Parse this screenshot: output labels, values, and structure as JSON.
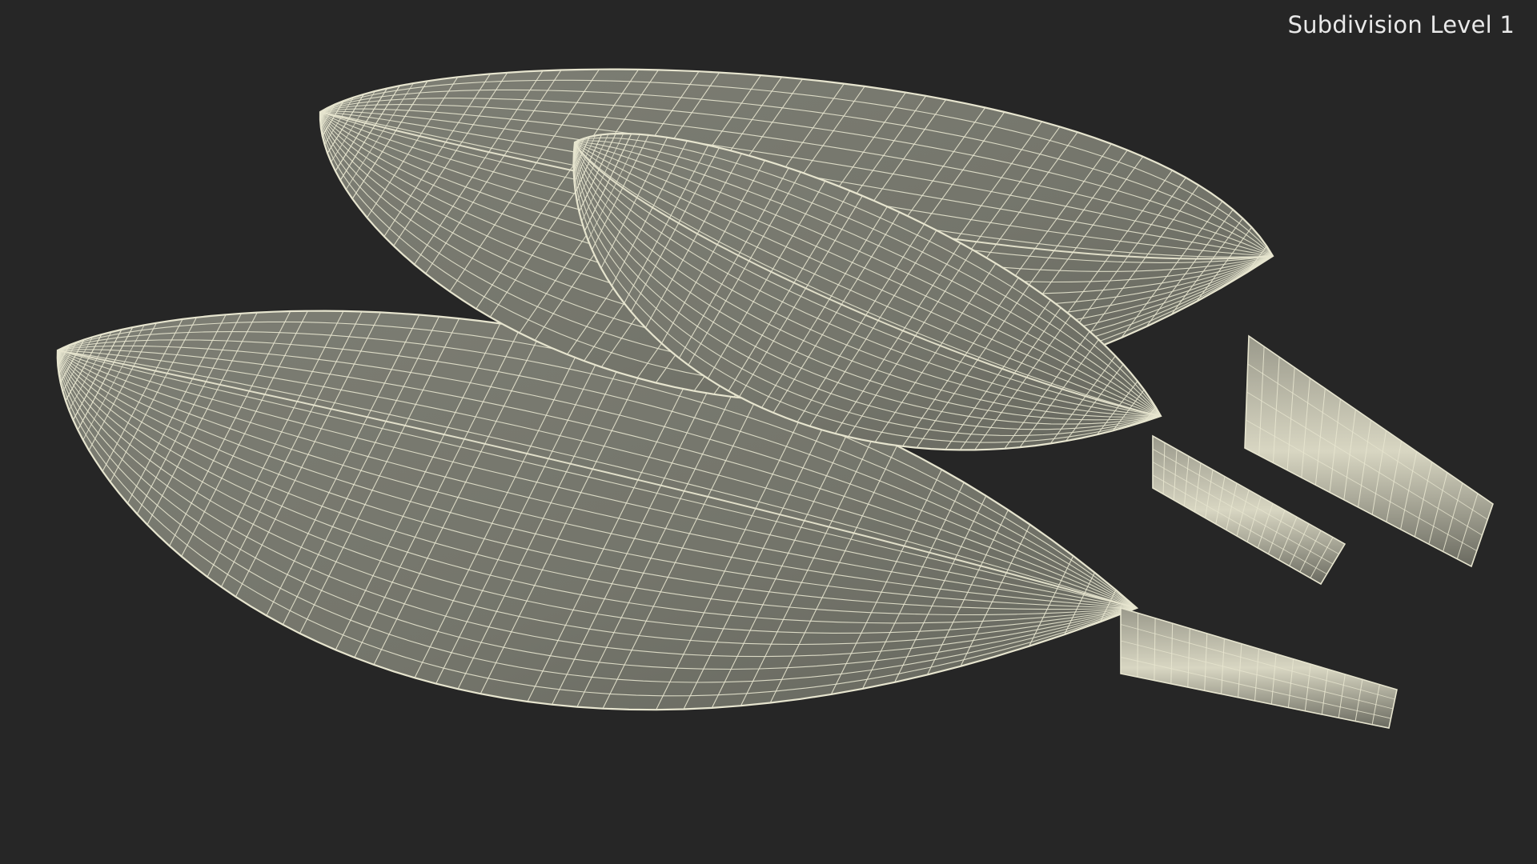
{
  "caption": "Subdivision Level 1",
  "colors": {
    "background": "#262626",
    "surface": "#77786e",
    "surface_dark": "#5d5e55",
    "wire": "#e7e5cf",
    "caption": "#e9e9e9"
  },
  "subject": {
    "leaves": [
      {
        "name": "bottom-leaf",
        "has_stem": true
      },
      {
        "name": "back-leaf",
        "has_stem": true
      },
      {
        "name": "front-leaf",
        "has_stem": true
      }
    ]
  }
}
